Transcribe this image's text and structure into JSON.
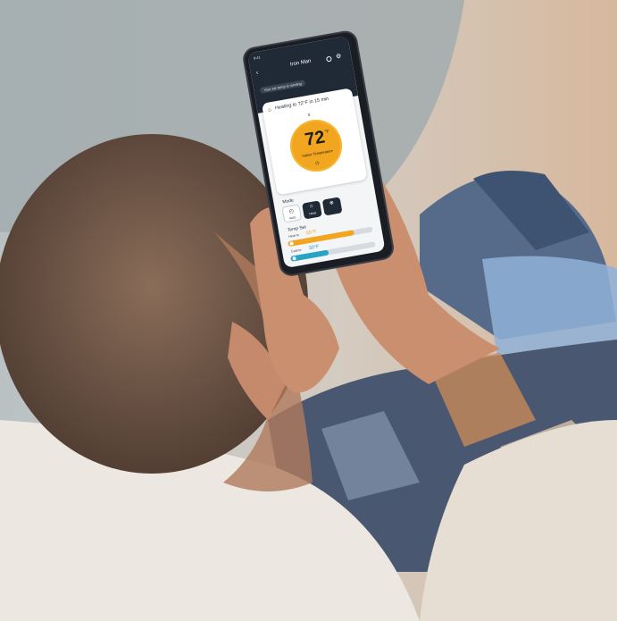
{
  "scene": {
    "colors": {
      "background_wall": "#d8cfc6",
      "chair": "#9aa4a6",
      "hair": "#6b5445",
      "skin": "#c98f6f",
      "shirt_blue": "#3e4d66",
      "shirt_orange": "#c78a59",
      "jeans": "#566b8a",
      "sofa": "#ece7e0"
    }
  },
  "app": {
    "time": "9:41",
    "back_icon": "back-arrow-icon",
    "device_name": "Iron Man",
    "icons": [
      "power-icon",
      "gear-icon"
    ],
    "status_text": "Your set temp is running",
    "heating_message": "Heating to 72°F in 15 min",
    "ring_marker": "8",
    "current_temp": "72",
    "temp_unit": "°F",
    "dial_label": "Indoor Temperature",
    "mode_title": "Mode",
    "modes": [
      {
        "label": "Auto",
        "icon": "auto-icon",
        "selected": false
      },
      {
        "label": "Heat",
        "icon": "sun-icon",
        "selected": true
      },
      {
        "label": "",
        "icon": "snowflake-icon",
        "selected": false
      }
    ],
    "temp_set_title": "Temp Set",
    "heat_to_label": "Heat to",
    "heat_to_value": "55°F",
    "heat_fill_fraction": 0.78,
    "cool_to_label": "Cool to",
    "cool_to_value": "30°F",
    "cool_fill_fraction": 0.45,
    "accent_heat": "#f2a51e",
    "accent_cool": "#27a3c4",
    "bar_dark": "#1f2a36"
  }
}
